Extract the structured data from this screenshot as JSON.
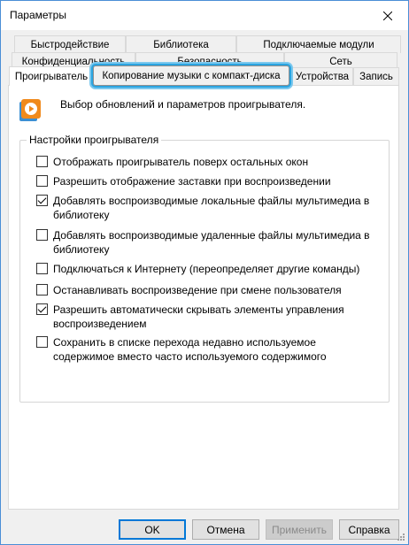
{
  "window": {
    "title": "Параметры"
  },
  "tabs": {
    "row1": [
      "Быстродействие",
      "Библиотека",
      "Подключаемые модули"
    ],
    "row2": [
      "Конфиденциальность",
      "Безопасность",
      "Сеть"
    ],
    "row3": [
      "Проигрыватель",
      "Копирование музыки с компакт-диска",
      "Устройства",
      "Запись"
    ]
  },
  "panel": {
    "intro": "Выбор обновлений и параметров проигрывателя.",
    "icon": "media-player-icon",
    "group_title": "Настройки проигрывателя",
    "options": [
      {
        "label": "Отображать проигрыватель поверх остальных окон",
        "checked": false
      },
      {
        "label": "Разрешить отображение заставки при воспроизведении",
        "checked": false
      },
      {
        "label": "Добавлять воспроизводимые локальные файлы мультимедиа в библиотеку",
        "checked": true
      },
      {
        "label": "Добавлять воспроизводимые удаленные файлы мультимедиа в библиотеку",
        "checked": false
      },
      {
        "label": "Подключаться к Интернету (переопределяет другие команды)",
        "checked": false
      },
      {
        "label": "Останавливать воспроизведение при смене пользователя",
        "checked": false
      },
      {
        "label": "Разрешить автоматически скрывать элементы управления воспроизведением",
        "checked": true
      },
      {
        "label": "Сохранить в списке перехода недавно используемое содержимое вместо часто используемого содержимого",
        "checked": false
      }
    ]
  },
  "buttons": {
    "ok": "OK",
    "cancel": "Отмена",
    "apply": "Применить",
    "help": "Справка"
  },
  "colors": {
    "highlight": "#2aa4e0",
    "window_border": "#4a8ed6",
    "default_button": "#0078d7"
  }
}
